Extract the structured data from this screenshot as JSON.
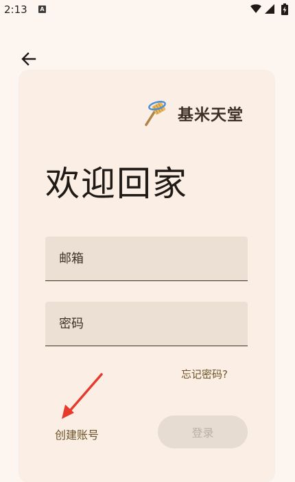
{
  "status_bar": {
    "time": "2:13",
    "notification_letter": "A",
    "icons": [
      "wifi-icon",
      "signal-icon",
      "battery-icon"
    ]
  },
  "nav": {
    "back_icon": "arrow-back-icon"
  },
  "brand": {
    "logo_icon": "broom-logo-icon",
    "name": "基米天堂"
  },
  "login": {
    "title": "欢迎回家",
    "email_placeholder": "邮箱",
    "password_placeholder": "密码",
    "forgot_password": "忘记密码?",
    "create_account": "创建账号",
    "login_button": "登录"
  },
  "colors": {
    "background": "#fdf6f0",
    "card": "#fbeee4",
    "field": "#ece0d5",
    "link": "#6b5326",
    "annotation_arrow": "#e53a2c"
  }
}
